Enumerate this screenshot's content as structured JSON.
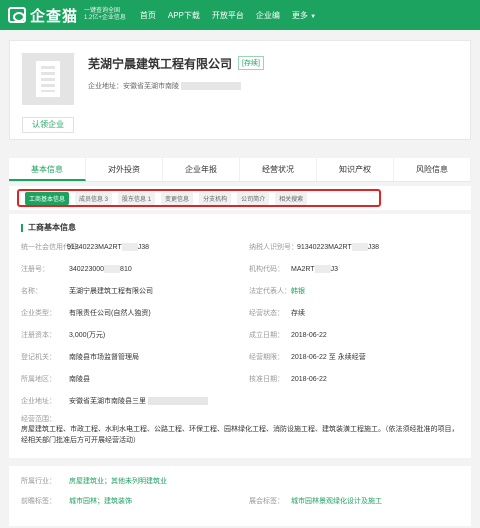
{
  "topbar": {
    "logo": "企查猫",
    "slogan_line1": "一键查询全国",
    "slogan_line2": "1.2亿+企业信息",
    "nav": [
      "首页",
      "APP下载",
      "开放平台",
      "企业编",
      "更多"
    ]
  },
  "company": {
    "name": "芜湖宁晨建筑工程有限公司",
    "status": "[存续]",
    "address_label": "企业地址：",
    "address": "安徽省芜湖市南陵",
    "auth_label": "认领企业"
  },
  "tabs": [
    "基本信息",
    "对外投资",
    "企业年报",
    "经营状况",
    "知识产权",
    "风险信息"
  ],
  "subtabs": [
    "工商基本信息",
    "成员信息 3",
    "股东信息 1",
    "变更信息",
    "分支机构",
    "公司简介",
    "相关搜索"
  ],
  "section_title": "工商基本信息",
  "rows": [
    {
      "l1": "统一社会信用代码：",
      "v1a": "91340223MA2RT",
      "v1b": "J38",
      "l2": "纳税人识别号：",
      "v2a": "91340223MA2RT",
      "v2b": "J38"
    },
    {
      "l1": "注册号：",
      "v1a": "340223000",
      "v1b": "810",
      "l2": "机构代码：",
      "v2a": "MA2RT",
      "v2b": "J3"
    },
    {
      "l1": "名称：",
      "v1a": "芜湖宁晨建筑工程有限公司",
      "v1b": "",
      "l2": "法定代表人：",
      "v2a": "韩银",
      "v2b": ""
    },
    {
      "l1": "企业类型：",
      "v1a": "有限责任公司(自然人独资)",
      "v1b": "",
      "l2": "经营状态：",
      "v2a": "存续",
      "v2b": ""
    },
    {
      "l1": "注册资本：",
      "v1a": "3,000(万元)",
      "v1b": "",
      "l2": "成立日期：",
      "v2a": "2018-06-22",
      "v2b": ""
    },
    {
      "l1": "登记机关：",
      "v1a": "南陵县市场监督管理局",
      "v1b": "",
      "l2": "经营期限：",
      "v2a": "2018-06-22 至 永续经营",
      "v2b": ""
    },
    {
      "l1": "所属地区：",
      "v1a": "南陵县",
      "v1b": "",
      "l2": "核准日期：",
      "v2a": "2018-06-22",
      "v2b": ""
    },
    {
      "l1": "企业地址：",
      "v1a": "安徽省芜湖市南陵县三里",
      "v1b": "",
      "l2": "",
      "v2a": "",
      "v2b": ""
    }
  ],
  "scope_label": "经营范围：",
  "scope_text": "房屋建筑工程、市政工程、水利水电工程、公路工程、环保工程、园林绿化工程、消防设施工程、建筑装潢工程施工。（依法须经批准的项目，经相关部门批准后方可开展经营活动）",
  "industry": {
    "label": "所属行业：",
    "value": "房屋建筑业；其他未列明建筑业"
  },
  "tags": {
    "label": "前瞻标签：",
    "value": "城市园林；建筑装饰",
    "label2": "展会标签：",
    "value2": "城市园林景观绿化设计及施工"
  }
}
